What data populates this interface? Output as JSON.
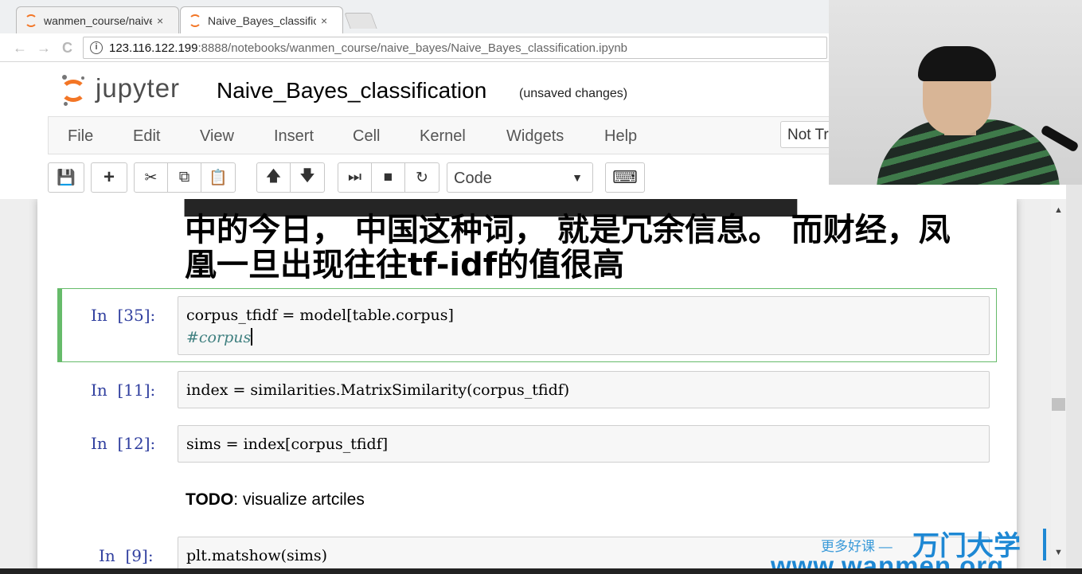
{
  "browser": {
    "tabs": [
      {
        "label": "wanmen_course/naive_",
        "close": "×"
      },
      {
        "label": "Naive_Bayes_classificat",
        "close": "×"
      }
    ],
    "nav": {
      "back": "←",
      "forward": "→",
      "reload": "C"
    },
    "url_info": "i",
    "url_host": "123.116.122.199",
    "url_path": ":8888/notebooks/wanmen_course/naive_bayes/Naive_Bayes_classification.ipynb"
  },
  "jupyter": {
    "brand": "jupyter",
    "notebook_title": "Naive_Bayes_classification",
    "save_status": "(unsaved changes)",
    "menu": [
      "File",
      "Edit",
      "View",
      "Insert",
      "Cell",
      "Kernel",
      "Widgets",
      "Help"
    ],
    "trusted_label": "Not Tr",
    "toolbar": {
      "save": "💾",
      "add": "+",
      "cut": "✂",
      "copy": "⧉",
      "paste": "📋",
      "up": "🡅",
      "down": "🡇",
      "run": "⏭",
      "stop": "■",
      "restart": "↻",
      "cell_type": "Code",
      "cell_type_caret": "▼",
      "keyboard": "⌨"
    }
  },
  "notebook": {
    "markdown_lines": [
      "中的今日， 中国这种词， 就是冗余信息。 而财经，凤",
      "凰一旦出现往往tf-idf的值很高"
    ],
    "cells": [
      {
        "prompt": "In  [35]:",
        "lines": [
          "corpus_tfidf = model[table.corpus]"
        ],
        "comment": "#corpus"
      },
      {
        "prompt": "In  [11]:",
        "lines": [
          "index = similarities.MatrixSimilarity(corpus_tfidf)"
        ]
      },
      {
        "prompt": "In  [12]:",
        "lines": [
          "sims = index[corpus_tfidf]"
        ]
      },
      {
        "prompt": "In  [9]:",
        "lines": [
          "plt.matshow(sims)"
        ]
      }
    ],
    "todo_bold": "TODO",
    "todo_text": ": visualize artciles"
  },
  "scrollbar": {
    "up": "▲",
    "down": "▼"
  },
  "watermark": {
    "tagline": "更多好课 —",
    "brand": "万门大学",
    "url": "www.wanmen.org"
  }
}
